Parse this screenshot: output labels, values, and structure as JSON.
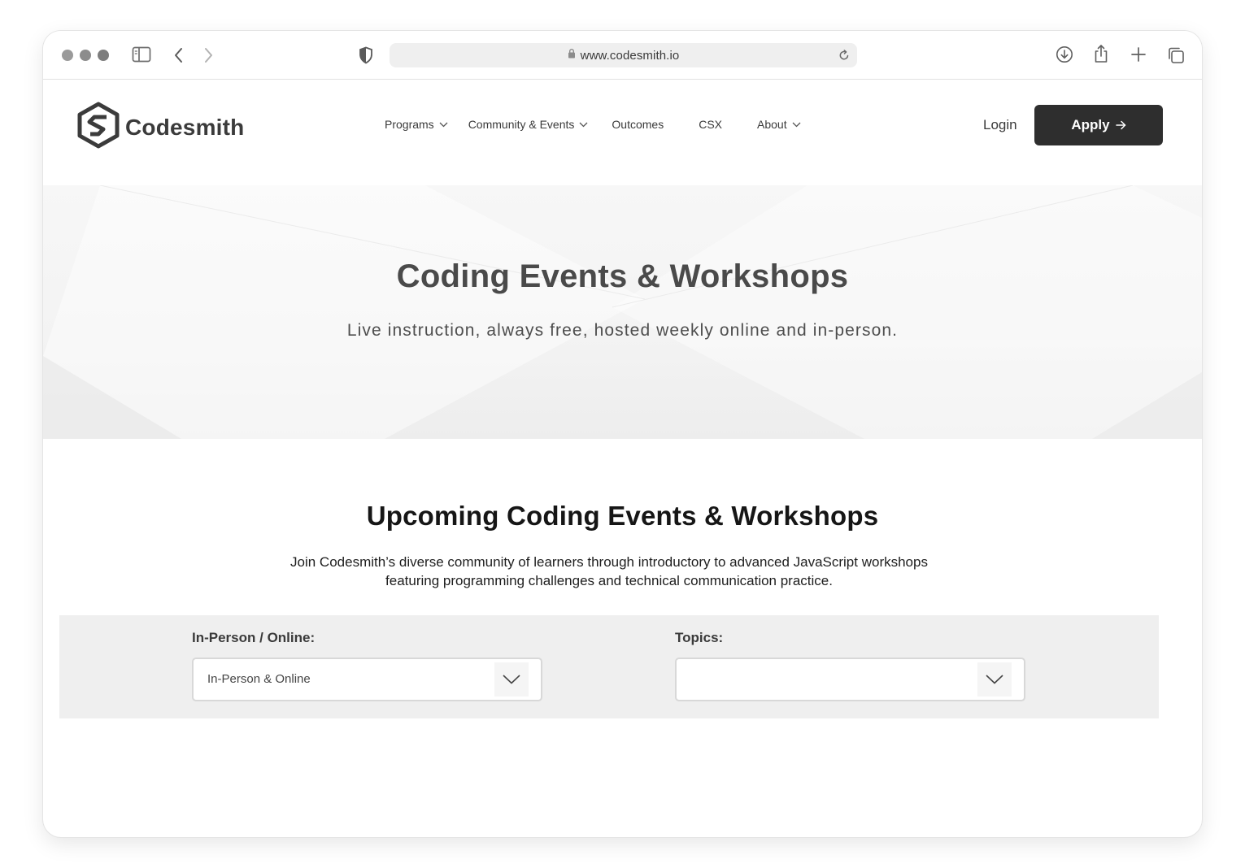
{
  "browser": {
    "url": "www.codesmith.io"
  },
  "site": {
    "brand": "Codesmith",
    "nav": [
      {
        "label": "Programs",
        "has_menu": true
      },
      {
        "label": "Community & Events",
        "has_menu": true
      },
      {
        "label": "Outcomes",
        "has_menu": false
      },
      {
        "label": "CSX",
        "has_menu": false
      },
      {
        "label": "About",
        "has_menu": true
      }
    ],
    "login_label": "Login",
    "apply_label": "Apply"
  },
  "hero": {
    "title": "Coding Events & Workshops",
    "subtitle": "Live instruction, always free, hosted weekly online and in-person."
  },
  "upcoming": {
    "title": "Upcoming Coding Events & Workshops",
    "description": "Join Codesmith’s diverse community of learners through introductory to advanced JavaScript workshops featuring programming challenges and technical communication practice."
  },
  "filters": {
    "mode_label": "In-Person / Online:",
    "mode_value": "In-Person & Online",
    "topics_label": "Topics:",
    "topics_value": ""
  },
  "colors": {
    "apply_bg": "#2e2e2e",
    "filter_bg": "#efefef",
    "hero_bg": "#f4f4f4"
  }
}
